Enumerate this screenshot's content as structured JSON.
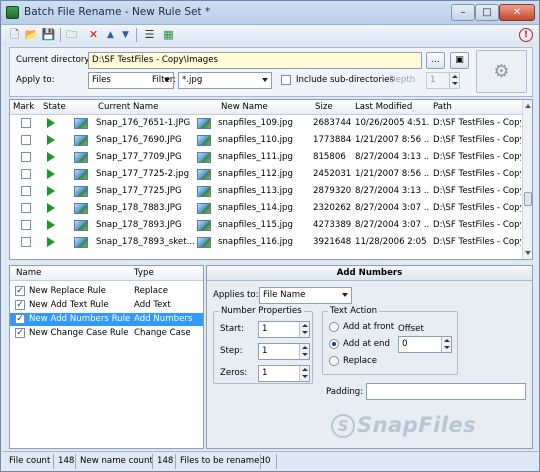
{
  "window": {
    "title": "Batch File Rename - New Rule Set *",
    "min": "–",
    "max": "□",
    "close": "✕"
  },
  "toolbar": {
    "icons": [
      "new-icon",
      "open-icon",
      "save-icon",
      "add-rule-icon",
      "delete-icon",
      "move-up-icon",
      "move-down-icon",
      "list-view-icon",
      "rename-icon"
    ],
    "glyphs": [
      "🗋",
      "📂",
      "💾",
      "🗀",
      "✕",
      "▲",
      "▼",
      "☰",
      "▦"
    ],
    "help": "!"
  },
  "filters": {
    "current_directory_label": "Current directory:",
    "current_directory": "D:\\SF TestFiles - Copy\\Images",
    "browse": "...",
    "apply_to_label": "Apply to:",
    "apply_to": "Files",
    "filter_label": "Filter:",
    "filter": "*.jpg",
    "subdirs_label": "Include sub-directories",
    "depth_label": "Depth",
    "depth": "1"
  },
  "grid": {
    "headers": [
      "Mark",
      "State",
      "Current Name",
      "New Name",
      "Size",
      "Last Modified",
      "Path"
    ],
    "rows": [
      {
        "current": "Snap_176_7651-1.JPG",
        "new": "snapfiles_109.jpg",
        "size": "2683744",
        "modified": "10/26/2005 4:51...",
        "path": "D:\\SF TestFiles - Copy\\"
      },
      {
        "current": "Snap_176_7690.JPG",
        "new": "snapfiles_110.jpg",
        "size": "1773884",
        "modified": "1/21/2007 8:56 ...",
        "path": "D:\\SF TestFiles - Copy\\"
      },
      {
        "current": "Snap_177_7709.JPG",
        "new": "snapfiles_111.jpg",
        "size": "815806",
        "modified": "8/27/2004 3:13 ...",
        "path": "D:\\SF TestFiles - Copy\\"
      },
      {
        "current": "Snap_177_7725-2.jpg",
        "new": "snapfiles_112.jpg",
        "size": "2452031",
        "modified": "1/21/2007 8:56 ...",
        "path": "D:\\SF TestFiles - Copy\\"
      },
      {
        "current": "Snap_177_7725.JPG",
        "new": "snapfiles_113.jpg",
        "size": "2879320",
        "modified": "8/27/2004 3:13 ...",
        "path": "D:\\SF TestFiles - Copy\\"
      },
      {
        "current": "Snap_178_7883.JPG",
        "new": "snapfiles_114.jpg",
        "size": "2320262",
        "modified": "8/27/2004 3:07 ...",
        "path": "D:\\SF TestFiles - Copy\\"
      },
      {
        "current": "Snap_178_7893.JPG",
        "new": "snapfiles_115.jpg",
        "size": "4273389",
        "modified": "8/27/2004 3:07 ...",
        "path": "D:\\SF TestFiles - Copy\\"
      },
      {
        "current": "Snap_178_7893_sket...",
        "new": "snapfiles_116.jpg",
        "size": "3921648",
        "modified": "11/28/2006 2:05 ...",
        "path": "D:\\SF TestFiles - Copy\\"
      }
    ]
  },
  "rules": {
    "headers": [
      "Name",
      "Type"
    ],
    "items": [
      {
        "name": "New Replace Rule",
        "type": "Replace",
        "checked": true
      },
      {
        "name": "New Add Text Rule",
        "type": "Add Text",
        "checked": true
      },
      {
        "name": "New Add Numbers Rule",
        "type": "Add Numbers",
        "checked": true,
        "selected": true
      },
      {
        "name": "New Change Case Rule",
        "type": "Change Case",
        "checked": true
      }
    ]
  },
  "props": {
    "title": "Add Numbers",
    "applies_to_label": "Applies to:",
    "applies_to": "File Name",
    "number_group": "Number Properties",
    "start_label": "Start:",
    "start": "1",
    "step_label": "Step:",
    "step": "1",
    "zeros_label": "Zeros:",
    "zeros": "1",
    "text_group": "Text Action",
    "add_front": "Add at front",
    "add_end": "Add at end",
    "replace": "Replace",
    "offset_label": "Offset",
    "offset": "0",
    "padding_label": "Padding:"
  },
  "watermark": {
    "text": "SnapFiles",
    "glyph": "S"
  },
  "status": {
    "file_count_label": "File count",
    "file_count": "148",
    "new_name_label": "New name count",
    "new_name_count": "148",
    "rename_label": "Files to be renamed",
    "rename_count": "0"
  }
}
